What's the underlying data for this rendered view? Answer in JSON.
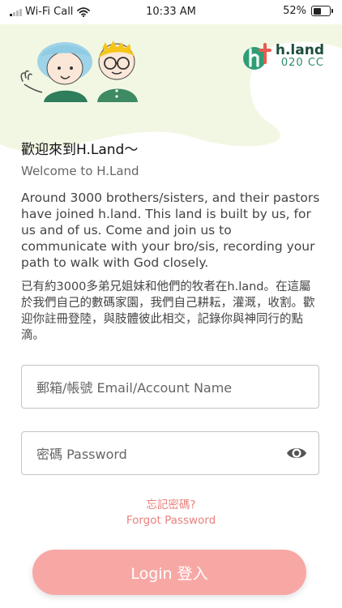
{
  "status_bar": {
    "carrier": "Wi-Fi Call",
    "time": "10:33 AM",
    "battery_percent": "52%",
    "battery_level": 0.52,
    "signal_bars": 1,
    "signal_icon": "signal-bars-icon",
    "wifi_icon": "wifi-icon",
    "battery_icon": "battery-icon"
  },
  "brand": {
    "name": "h.land",
    "subtitle": "020 CC",
    "logo_icon": "h-cross-logo-icon",
    "logo_colors": [
      "#2e9d75",
      "#e85a4f"
    ]
  },
  "illustration": {
    "icon": "waving-kids-illustration"
  },
  "welcome": {
    "title_zh": "歡迎來到H.Land～",
    "title_en": "Welcome to H.Land",
    "intro_en": "Around 3000 brothers/sisters, and their pastors have joined h.land. This land is built by us, for us and of us. Come and join us to communicate with your bro/sis, recording your path to walk with God closely.",
    "intro_zh": "已有約3000多弟兄姐妹和他們的牧者在h.land。在這屬於我們自己的數碼家園，我們自己耕耘，灌溉，收割。歡迎你註冊登陸，與肢體彼此相交，記錄你與神同行的點滴。"
  },
  "form": {
    "account_placeholder": "郵箱/帳號 Email/Account Name",
    "account_value": "",
    "password_placeholder": "密碼 Password",
    "password_value": "",
    "show_password_icon": "eye-icon"
  },
  "forgot": {
    "zh": "忘記密碼?",
    "en": "Forgot Password"
  },
  "login_button": {
    "label": "Login 登入"
  },
  "colors": {
    "hero_background": "#f2f7e3",
    "accent_pink": "#f7a8a5",
    "link_color": "#e9807d",
    "brand_green": "#1d4d3d"
  }
}
